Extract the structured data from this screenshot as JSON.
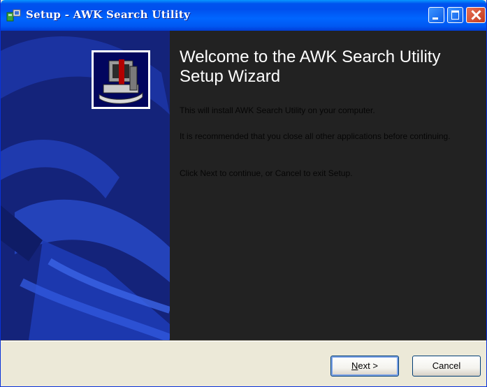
{
  "window": {
    "title": "Setup - AWK Search Utility"
  },
  "wizard": {
    "heading": "Welcome to the AWK Search Utility Setup Wizard",
    "para1": "This will install AWK Search Utility on your computer.",
    "para2": "It is recommended that you close all other applications before continuing.",
    "para3": "Click Next to continue, or Cancel to exit Setup."
  },
  "buttons": {
    "next_mnemonic": "N",
    "next_rest": "ext >",
    "cancel": "Cancel"
  },
  "colors": {
    "titlebar": "#0058f2",
    "sidebar": "#15247a",
    "content_bg": "#222222",
    "button_face": "#f4f3ee"
  },
  "icons": [
    "setup-icon",
    "minimize-icon",
    "maximize-icon",
    "close-icon",
    "computer-install-icon"
  ]
}
